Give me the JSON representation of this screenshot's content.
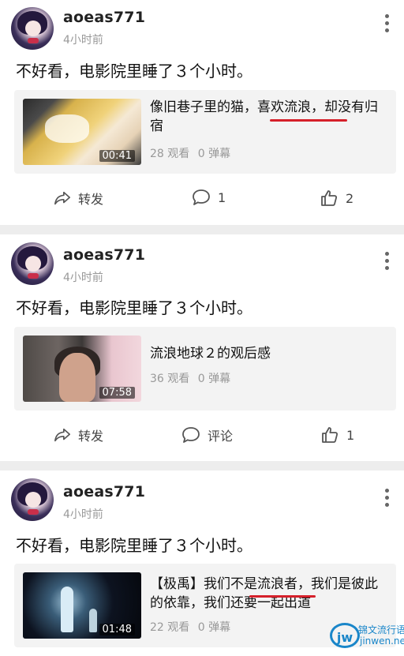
{
  "posts": [
    {
      "username": "aoeas771",
      "time": "4小时前",
      "text": "不好看，电影院里睡了３个小时。",
      "video": {
        "title": "像旧巷子里的猫，喜欢流浪，却没有归宿",
        "duration": "00:41",
        "views": "28 观看",
        "danmaku": "0 弹幕"
      },
      "actions": {
        "share_label": "转发",
        "comment_label": "1",
        "like_label": "2"
      }
    },
    {
      "username": "aoeas771",
      "time": "4小时前",
      "text": "不好看，电影院里睡了３个小时。",
      "video": {
        "title": "流浪地球２的观后感",
        "duration": "07:58",
        "views": "36 观看",
        "danmaku": "0 弹幕"
      },
      "actions": {
        "share_label": "转发",
        "comment_label": "评论",
        "like_label": "1"
      }
    },
    {
      "username": "aoeas771",
      "time": "4小时前",
      "text": "不好看，电影院里睡了３个小时。",
      "video": {
        "title": "【极禹】我们不是流浪者，我们是彼此的依靠，我们还要一起出道",
        "duration": "01:48",
        "views": "22 观看",
        "danmaku": "0 弹幕"
      }
    }
  ],
  "watermark": {
    "mark": "jw",
    "name": "锦文流行语",
    "domain": "jinwen.net"
  },
  "colors": {
    "background": "#ededed",
    "card": "#ffffff",
    "embed": "#f3f3f3",
    "underline": "#d5202a",
    "meta": "#999999"
  },
  "icons": [
    "more-icon",
    "share-icon",
    "comment-icon",
    "like-icon"
  ]
}
